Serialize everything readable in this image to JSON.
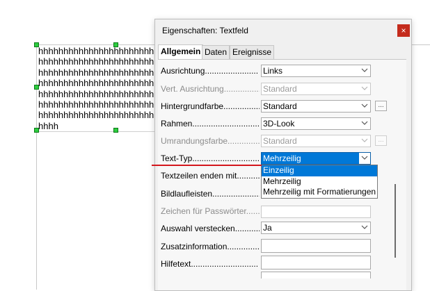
{
  "document": {
    "textfield_lines": [
      "hhhhhhhhhhhhhhhhhhhhhhhh",
      "hhhhhhhhhhhhhhhhhhhhhhhh",
      "hhhhhhhhhhhhhhhhhhhhhhhh",
      "hhhhhhhhhhhhhhhhhhhhhhhh",
      "hhhhhhhhhhhhhhhhhhhhhhhh",
      "hhhhhhhhhhhhhhhhhhhhhhhh",
      "hhhhhhhhhhhhhhhhhhhhhhhh",
      "hhhh"
    ]
  },
  "dialog": {
    "title": "Eigenschaften: Textfeld",
    "close_label": "×",
    "tabs": [
      "Allgemein",
      "Daten",
      "Ereignisse"
    ],
    "rows": [
      {
        "label": "Ausrichtung.......................",
        "value": "Links"
      },
      {
        "label": "Vert. Ausrichtung................",
        "value": "Standard"
      },
      {
        "label": "Hintergrundfarbe..................",
        "value": "Standard"
      },
      {
        "label": "Rahmen...............................",
        "value": "3D-Look"
      },
      {
        "label": "Umrandungsfarbe...............",
        "value": "Standard"
      },
      {
        "label": "Text-Typ...............................",
        "value": "Mehrzeilig"
      },
      {
        "label": "Textzeilen enden mit............",
        "value": ""
      },
      {
        "label": "Bildlaufleisten.........................",
        "value": ""
      },
      {
        "label": "Zeichen für Passwörter........",
        "value": ""
      },
      {
        "label": "Auswahl verstecken.............",
        "value": "Ja"
      },
      {
        "label": "Zusatzinformation.................",
        "value": ""
      },
      {
        "label": "Hilfetext.............................",
        "value": ""
      }
    ],
    "more_button_label": "...",
    "dropdown_options": [
      "Einzeilig",
      "Mehrzeilig",
      "Mehrzeilig mit Formatierungen"
    ]
  },
  "colors": {
    "selection": "#0078d7",
    "close_button": "#c42b1c",
    "handle": "#2ecc40",
    "annotation_underline": "#d4161c"
  }
}
